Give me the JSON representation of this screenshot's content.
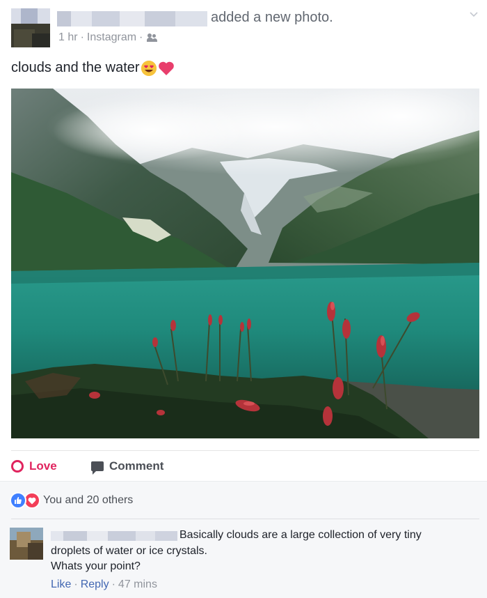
{
  "post": {
    "headline_suffix": "added a new photo.",
    "time": "1 hr",
    "separator": "·",
    "app": "Instagram",
    "audience_icon": "friends-icon",
    "caption": "clouds and the water",
    "caption_emojis": [
      "heart-eyes-emoji",
      "heart-emoji"
    ],
    "menu_icon": "chevron-down-icon"
  },
  "actions": {
    "love_label": "Love",
    "comment_label": "Comment"
  },
  "reactions": {
    "icons": [
      "like-icon",
      "love-icon"
    ],
    "summary": "You and 20 others"
  },
  "comment": {
    "line1": "Basically clouds are a large collection of very tiny",
    "line2": "droplets of water or ice crystals.",
    "line3": "Whats your point?",
    "like_label": "Like",
    "reply_label": "Reply",
    "separator": "·",
    "time": "47 mins"
  },
  "colors": {
    "love": "#e0245e",
    "link": "#4267b2",
    "meta": "#90949c",
    "like_blue": "#4080ff",
    "love_red": "#f33e58"
  }
}
